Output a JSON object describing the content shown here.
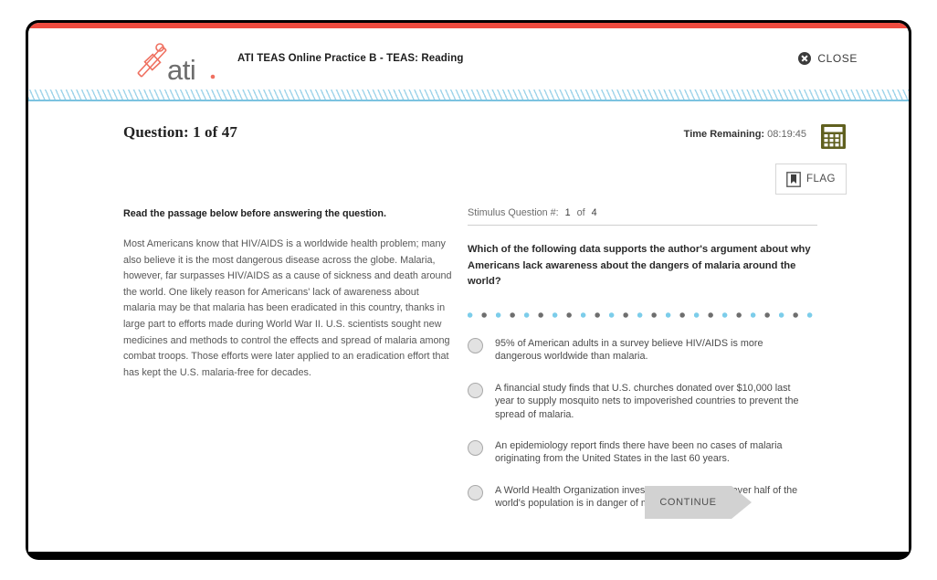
{
  "window": {
    "accent_bar_color": "#ef4b3f",
    "frame_color": "#000000"
  },
  "header": {
    "logo_alt": "ati.",
    "logo_wordmark": "ati.",
    "title": "ATI TEAS Online Practice B - TEAS: Reading",
    "close_label": "CLOSE"
  },
  "toolbar": {
    "question_counter": "Question: 1 of 47",
    "timer_label": "Time Remaining:",
    "timer_value": "08:19:45",
    "flag_label": "FLAG",
    "calculator_icon_color": "#60601f"
  },
  "passage": {
    "instruction": "Read the passage below before answering the question.",
    "body": "Most Americans know that HIV/AIDS is a worldwide health problem; many also believe it is the most dangerous disease across the globe. Malaria, however, far surpasses HIV/AIDS as a cause of sickness and death around the world. One likely reason for Americans' lack of awareness about malaria may be that malaria has been eradicated in this country, thanks in large part to efforts made during World War II. U.S. scientists sought new medicines and methods to control the effects and spread of malaria among combat troops. Those efforts were later applied to an eradication effort that has kept the U.S. malaria-free for decades."
  },
  "stimulus": {
    "label": "Stimulus Question #:",
    "index": "1",
    "of": "of",
    "total": "4"
  },
  "question": {
    "text": "Which of the following data supports the author's argument about why Americans lack awareness about the dangers of malaria around the world?",
    "options": [
      {
        "text": "95% of American adults in a survey believe HIV/AIDS is more dangerous worldwide than malaria.",
        "selected": false
      },
      {
        "text": "A financial study finds that U.S. churches donated over $10,000 last year to supply mosquito nets to impoverished countries to prevent the spread of malaria.",
        "selected": false
      },
      {
        "text": "An epidemiology report finds there have been no cases of malaria originating from the United States in the last 60 years.",
        "selected": false
      },
      {
        "text": "A World Health Organization investigation reports that over half of the world's population is in danger of malaria.",
        "selected": false
      }
    ]
  },
  "footer": {
    "continue_label": "CONTINUE"
  },
  "divider": {
    "dot_color_blue": "#7ccdea",
    "dot_color_gray": "#6e6e6e"
  }
}
